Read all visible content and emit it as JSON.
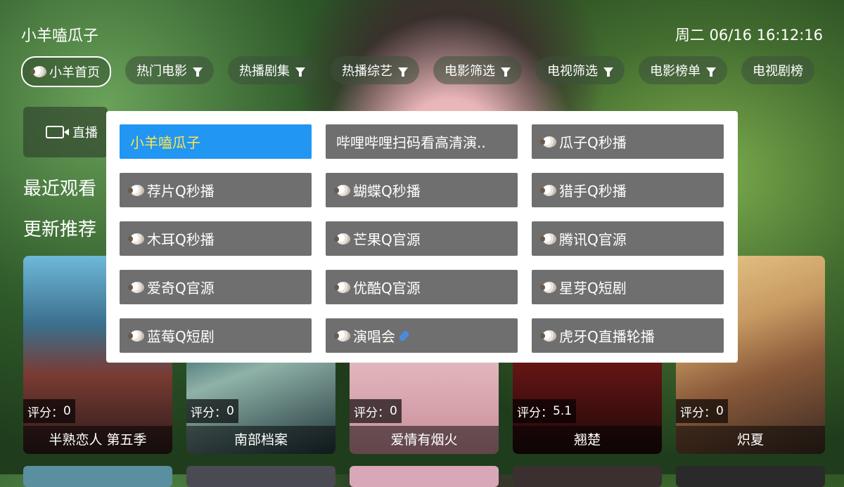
{
  "header": {
    "app_title": "小羊嗑瓜子",
    "clock": "周二 06/16 16:12:16"
  },
  "tabs": [
    {
      "label": "小羊首页",
      "active": true,
      "filter": false
    },
    {
      "label": "热门电影",
      "filter": true
    },
    {
      "label": "热播剧集",
      "filter": true
    },
    {
      "label": "热播综艺",
      "filter": true
    },
    {
      "label": "电影筛选",
      "filter": true
    },
    {
      "label": "电视筛选",
      "filter": true
    },
    {
      "label": "电影榜单",
      "filter": true
    },
    {
      "label": "电视剧榜",
      "filter": true
    }
  ],
  "live_button": {
    "label": "直播",
    "icon": "video-camera-icon"
  },
  "sections": {
    "recent": "最近观看",
    "updates": "更新推荐"
  },
  "posters": [
    {
      "title": "半熟恋人 第五季",
      "rating_label": "评分：",
      "rating": "0"
    },
    {
      "title": "南部档案",
      "rating_label": "评分：",
      "rating": "0"
    },
    {
      "title": "爱情有烟火",
      "rating_label": "评分：",
      "rating": "0"
    },
    {
      "title": "翘楚",
      "rating_label": "评分：",
      "rating": "5.1"
    },
    {
      "title": "炽夏",
      "rating_label": "评分：",
      "rating": "0"
    }
  ],
  "source_dialog": {
    "items": [
      {
        "label": "小羊嗑瓜子",
        "selected": true,
        "icon": ""
      },
      {
        "label": "哔哩哔哩扫码看高清演..",
        "icon": ""
      },
      {
        "label": "瓜子Q秒播",
        "icon": "sheep-icon"
      },
      {
        "label": "荐片Q秒播",
        "icon": "sheep-icon"
      },
      {
        "label": "蝴蝶Q秒播",
        "icon": "sheep-icon"
      },
      {
        "label": "猎手Q秒播",
        "icon": "sheep-icon"
      },
      {
        "label": "木耳Q秒播",
        "icon": "sheep-icon"
      },
      {
        "label": "芒果Q官源",
        "icon": "sheep-icon"
      },
      {
        "label": "腾讯Q官源",
        "icon": "sheep-icon"
      },
      {
        "label": "爱奇Q官源",
        "icon": "sheep-icon"
      },
      {
        "label": "优酷Q官源",
        "icon": "sheep-icon"
      },
      {
        "label": "星芽Q短剧",
        "icon": "sheep-icon"
      },
      {
        "label": "蓝莓Q短剧",
        "icon": "sheep-icon"
      },
      {
        "label": "演唱会",
        "icon": "sheep-icon",
        "trailing_icon": "microphone-icon"
      },
      {
        "label": "虎牙Q直播轮播",
        "icon": "sheep-icon"
      }
    ]
  },
  "colors": {
    "selected_bg": "#2196f3",
    "selected_text": "#ffe54a",
    "item_bg": "#6f6f6f",
    "dialog_bg": "#ffffff"
  }
}
